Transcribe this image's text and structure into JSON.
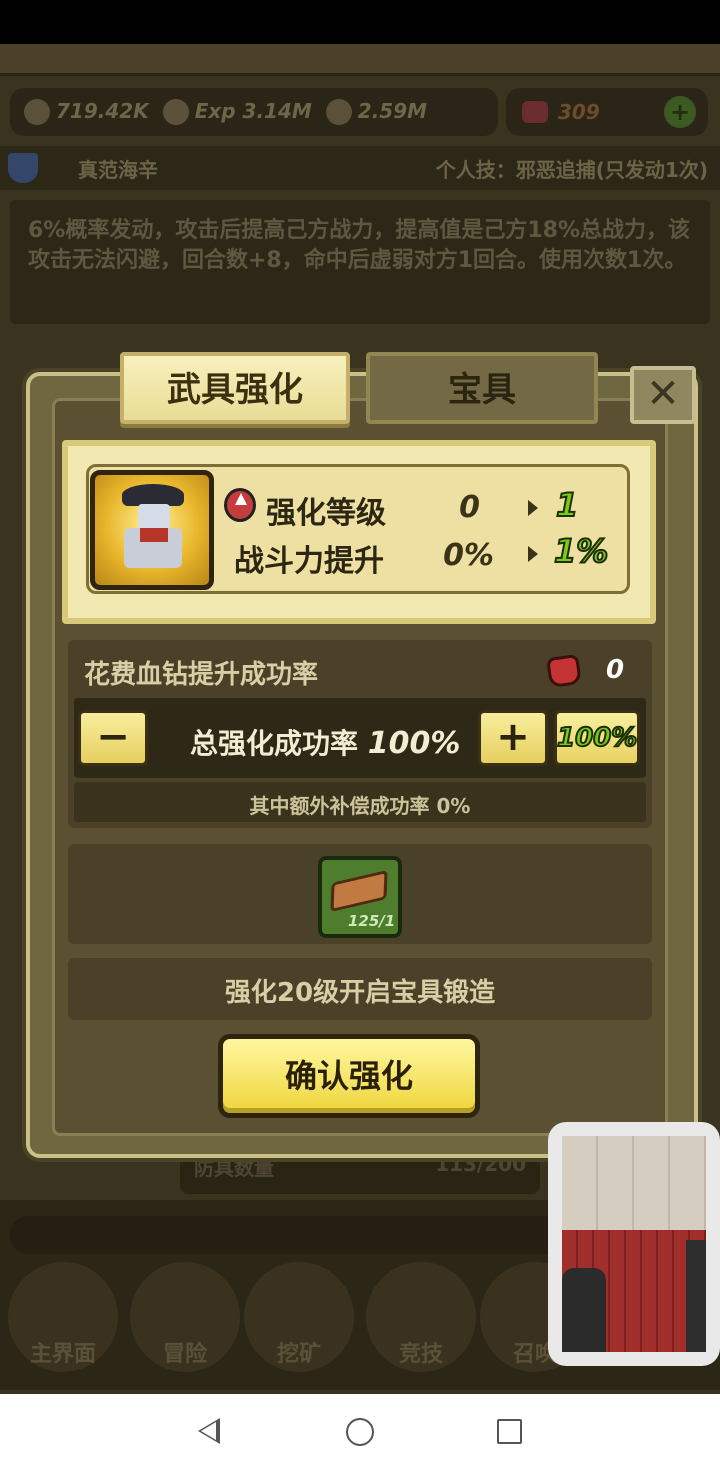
{
  "resources": {
    "power": "719.42K",
    "exp": "3.14M",
    "gold": "2.59M",
    "gems": "309",
    "exp_tag": "Exp"
  },
  "skill": {
    "hero_name": "真范海辛",
    "personal_skill": "个人技：邪恶追捕(只发动1次)",
    "description": "6%概率发动，攻击后提高己方战力，提高值是己方18%总战力，该攻击无法闪避，回合数+8，命中后虚弱对方1回合。使用次数1次。"
  },
  "dialog": {
    "tab_active": "武具强化",
    "tab_inactive": "宝具",
    "close_symbol": "✕"
  },
  "upgrade": {
    "level_label": "强化等级",
    "level_old": "0",
    "level_new": "1",
    "power_label": "战斗力提升",
    "power_old": "0%",
    "power_new": "1%"
  },
  "rate": {
    "title": "花费血钻提升成功率",
    "gem_cost": "0",
    "minus": "−",
    "plus": "+",
    "total_label": "总强化成功率",
    "total_value": "100%",
    "badge_value": "100%",
    "extra_text": "其中额外补偿成功率 0%"
  },
  "material": {
    "count": "125/1"
  },
  "notice": "强化20级开启宝具锻造",
  "confirm_label": "确认强化",
  "background": {
    "hidden_row_label": "防具数量",
    "hidden_row_value": "113/200",
    "nav": [
      "主界面",
      "冒险",
      "挖矿",
      "竞技",
      "召唤"
    ]
  },
  "colors": {
    "accent_green": "#79cb15",
    "gem_red": "#c53434",
    "button_yellow": "#eed53a"
  }
}
